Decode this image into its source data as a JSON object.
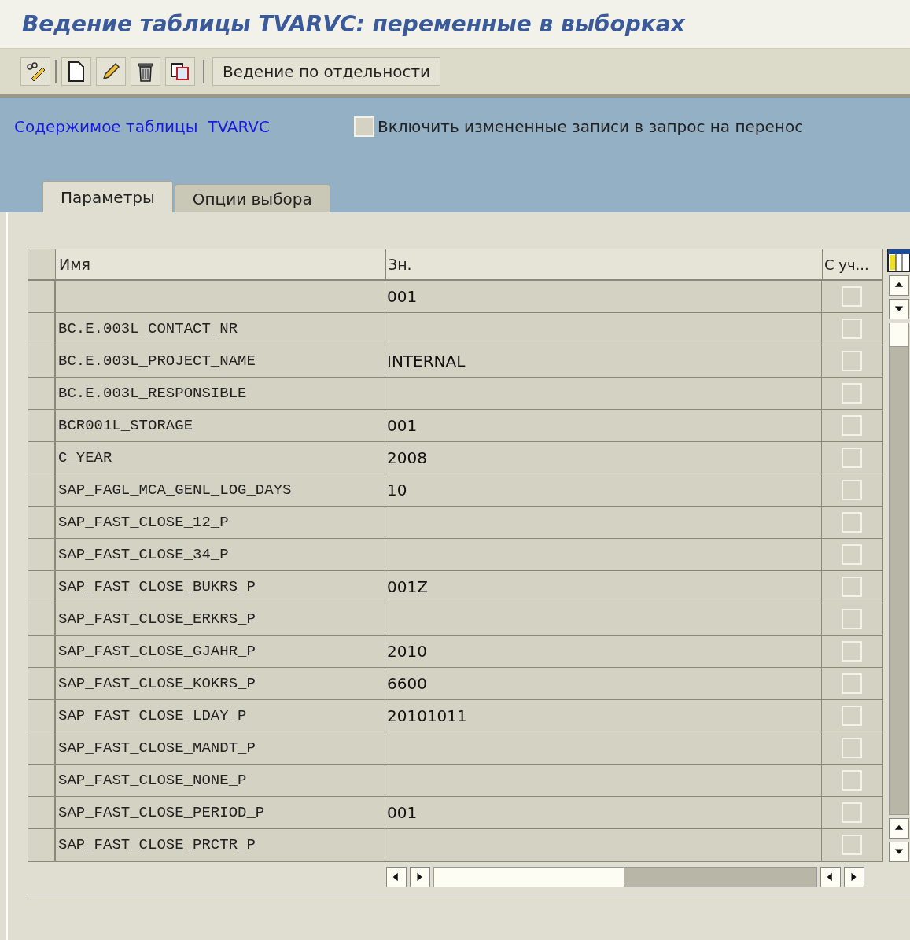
{
  "window": {
    "title": "Ведение таблицы TVARVC: переменные в выборках"
  },
  "toolbar": {
    "buttons": [
      {
        "kind": "display-change"
      },
      {
        "kind": "new"
      },
      {
        "kind": "edit"
      },
      {
        "kind": "delete"
      },
      {
        "kind": "copy"
      }
    ],
    "text_button": "Ведение по отдельности"
  },
  "header": {
    "label": "Содержимое таблицы  TVARVC",
    "checkbox": {
      "label": "Включить измененные записи в запрос на перенос",
      "checked": false
    }
  },
  "tabs": [
    {
      "label": "Параметры",
      "selected": true
    },
    {
      "label": "Опции выбора",
      "selected": false
    }
  ],
  "table": {
    "columns": [
      "Имя",
      "Зн.",
      "С уч..."
    ],
    "rows": [
      {
        "name": "",
        "value": "001",
        "checked": false
      },
      {
        "name": "BC.E.003L_CONTACT_NR",
        "value": "",
        "checked": false
      },
      {
        "name": "BC.E.003L_PROJECT_NAME",
        "value": "INTERNAL",
        "checked": false
      },
      {
        "name": "BC.E.003L_RESPONSIBLE",
        "value": "",
        "checked": false
      },
      {
        "name": "BCR001L_STORAGE",
        "value": "001",
        "checked": false
      },
      {
        "name": "C_YEAR",
        "value": "2008",
        "checked": false
      },
      {
        "name": "SAP_FAGL_MCA_GENL_LOG_DAYS",
        "value": "10",
        "checked": false
      },
      {
        "name": "SAP_FAST_CLOSE_12_P",
        "value": "",
        "checked": false
      },
      {
        "name": "SAP_FAST_CLOSE_34_P",
        "value": "",
        "checked": false
      },
      {
        "name": "SAP_FAST_CLOSE_BUKRS_P",
        "value": "001Z",
        "checked": false
      },
      {
        "name": "SAP_FAST_CLOSE_ERKRS_P",
        "value": "",
        "checked": false
      },
      {
        "name": "SAP_FAST_CLOSE_GJAHR_P",
        "value": "2010",
        "checked": false
      },
      {
        "name": "SAP_FAST_CLOSE_KOKRS_P",
        "value": "6600",
        "checked": false
      },
      {
        "name": "SAP_FAST_CLOSE_LDAY_P",
        "value": "20101011",
        "checked": false
      },
      {
        "name": "SAP_FAST_CLOSE_MANDT_P",
        "value": "",
        "checked": false
      },
      {
        "name": "SAP_FAST_CLOSE_NONE_P",
        "value": "",
        "checked": false
      },
      {
        "name": "SAP_FAST_CLOSE_PERIOD_P",
        "value": "001",
        "checked": false
      },
      {
        "name": "SAP_FAST_CLOSE_PRCTR_P",
        "value": "",
        "checked": false
      }
    ]
  }
}
